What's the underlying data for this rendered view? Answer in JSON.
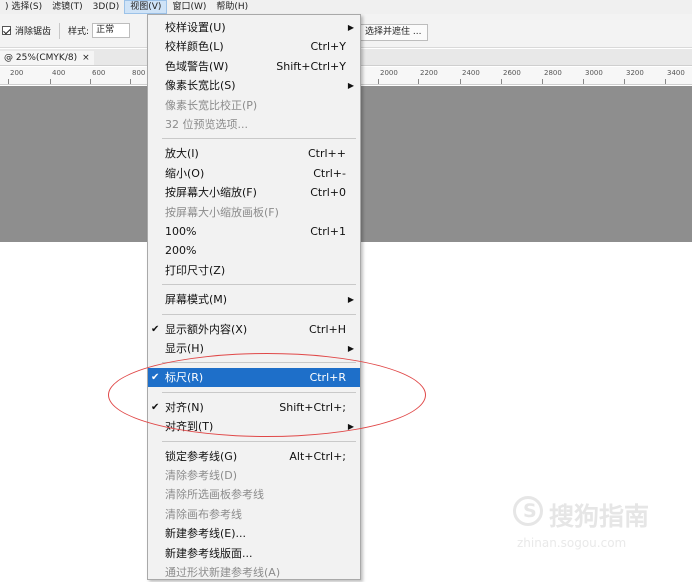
{
  "menubar": {
    "items": [
      ") 选择(S)",
      "滤镜(T)",
      "3D(D)",
      "视图(V)",
      "窗口(W)",
      "帮助(H)"
    ],
    "active_index": 3
  },
  "options_bar": {
    "antialias_label": "消除锯齿",
    "style_label": "样式:",
    "style_value": "正常",
    "select_mask_label": "选择并遮住 ..."
  },
  "document_tab": {
    "label": "@ 25%(CMYK/8)",
    "close": "×"
  },
  "ruler": {
    "ticks": [
      "200",
      "400",
      "600",
      "800",
      "2000",
      "2200",
      "2400",
      "2600",
      "2800",
      "3000",
      "3200",
      "3400"
    ]
  },
  "view_menu": {
    "items": [
      {
        "label": "校样设置(U)",
        "shortcut": "",
        "submenu": true,
        "disabled": false,
        "checked": false,
        "highlighted": false
      },
      {
        "label": "校样颜色(L)",
        "shortcut": "Ctrl+Y",
        "submenu": false,
        "disabled": false,
        "checked": false,
        "highlighted": false
      },
      {
        "label": "色域警告(W)",
        "shortcut": "Shift+Ctrl+Y",
        "submenu": false,
        "disabled": false,
        "checked": false,
        "highlighted": false
      },
      {
        "label": "像素长宽比(S)",
        "shortcut": "",
        "submenu": true,
        "disabled": false,
        "checked": false,
        "highlighted": false
      },
      {
        "label": "像素长宽比校正(P)",
        "shortcut": "",
        "submenu": false,
        "disabled": true,
        "checked": false,
        "highlighted": false
      },
      {
        "label": "32 位预览选项...",
        "shortcut": "",
        "submenu": false,
        "disabled": true,
        "checked": false,
        "highlighted": false
      },
      {
        "sep": true
      },
      {
        "label": "放大(I)",
        "shortcut": "Ctrl++",
        "submenu": false,
        "disabled": false,
        "checked": false,
        "highlighted": false
      },
      {
        "label": "缩小(O)",
        "shortcut": "Ctrl+-",
        "submenu": false,
        "disabled": false,
        "checked": false,
        "highlighted": false
      },
      {
        "label": "按屏幕大小缩放(F)",
        "shortcut": "Ctrl+0",
        "submenu": false,
        "disabled": false,
        "checked": false,
        "highlighted": false
      },
      {
        "label": "按屏幕大小缩放画板(F)",
        "shortcut": "",
        "submenu": false,
        "disabled": true,
        "checked": false,
        "highlighted": false
      },
      {
        "label": "100%",
        "shortcut": "Ctrl+1",
        "submenu": false,
        "disabled": false,
        "checked": false,
        "highlighted": false
      },
      {
        "label": "200%",
        "shortcut": "",
        "submenu": false,
        "disabled": false,
        "checked": false,
        "highlighted": false
      },
      {
        "label": "打印尺寸(Z)",
        "shortcut": "",
        "submenu": false,
        "disabled": false,
        "checked": false,
        "highlighted": false
      },
      {
        "sep": true
      },
      {
        "label": "屏幕模式(M)",
        "shortcut": "",
        "submenu": true,
        "disabled": false,
        "checked": false,
        "highlighted": false
      },
      {
        "sep": true
      },
      {
        "label": "显示额外内容(X)",
        "shortcut": "Ctrl+H",
        "submenu": false,
        "disabled": false,
        "checked": true,
        "highlighted": false
      },
      {
        "label": "显示(H)",
        "shortcut": "",
        "submenu": true,
        "disabled": false,
        "checked": false,
        "highlighted": false
      },
      {
        "sep": true
      },
      {
        "label": "标尺(R)",
        "shortcut": "Ctrl+R",
        "submenu": false,
        "disabled": false,
        "checked": true,
        "highlighted": true
      },
      {
        "sep": true
      },
      {
        "label": "对齐(N)",
        "shortcut": "Shift+Ctrl+;",
        "submenu": false,
        "disabled": false,
        "checked": true,
        "highlighted": false
      },
      {
        "label": "对齐到(T)",
        "shortcut": "",
        "submenu": true,
        "disabled": false,
        "checked": false,
        "highlighted": false
      },
      {
        "sep": true
      },
      {
        "label": "锁定参考线(G)",
        "shortcut": "Alt+Ctrl+;",
        "submenu": false,
        "disabled": false,
        "checked": false,
        "highlighted": false
      },
      {
        "label": "清除参考线(D)",
        "shortcut": "",
        "submenu": false,
        "disabled": true,
        "checked": false,
        "highlighted": false
      },
      {
        "label": "清除所选画板参考线",
        "shortcut": "",
        "submenu": false,
        "disabled": true,
        "checked": false,
        "highlighted": false
      },
      {
        "label": "清除画布参考线",
        "shortcut": "",
        "submenu": false,
        "disabled": true,
        "checked": false,
        "highlighted": false
      },
      {
        "label": "新建参考线(E)...",
        "shortcut": "",
        "submenu": false,
        "disabled": false,
        "checked": false,
        "highlighted": false
      },
      {
        "label": "新建参考线版面...",
        "shortcut": "",
        "submenu": false,
        "disabled": false,
        "checked": false,
        "highlighted": false
      },
      {
        "label": "通过形状新建参考线(A)",
        "shortcut": "",
        "submenu": false,
        "disabled": true,
        "checked": false,
        "highlighted": false
      }
    ]
  },
  "watermark": {
    "text": "搜狗指南",
    "url": "zhinan.sogou.com"
  },
  "colors": {
    "highlight": "#1e6fc9",
    "annotation": "#e04848",
    "canvas": "#8e8e8e"
  }
}
